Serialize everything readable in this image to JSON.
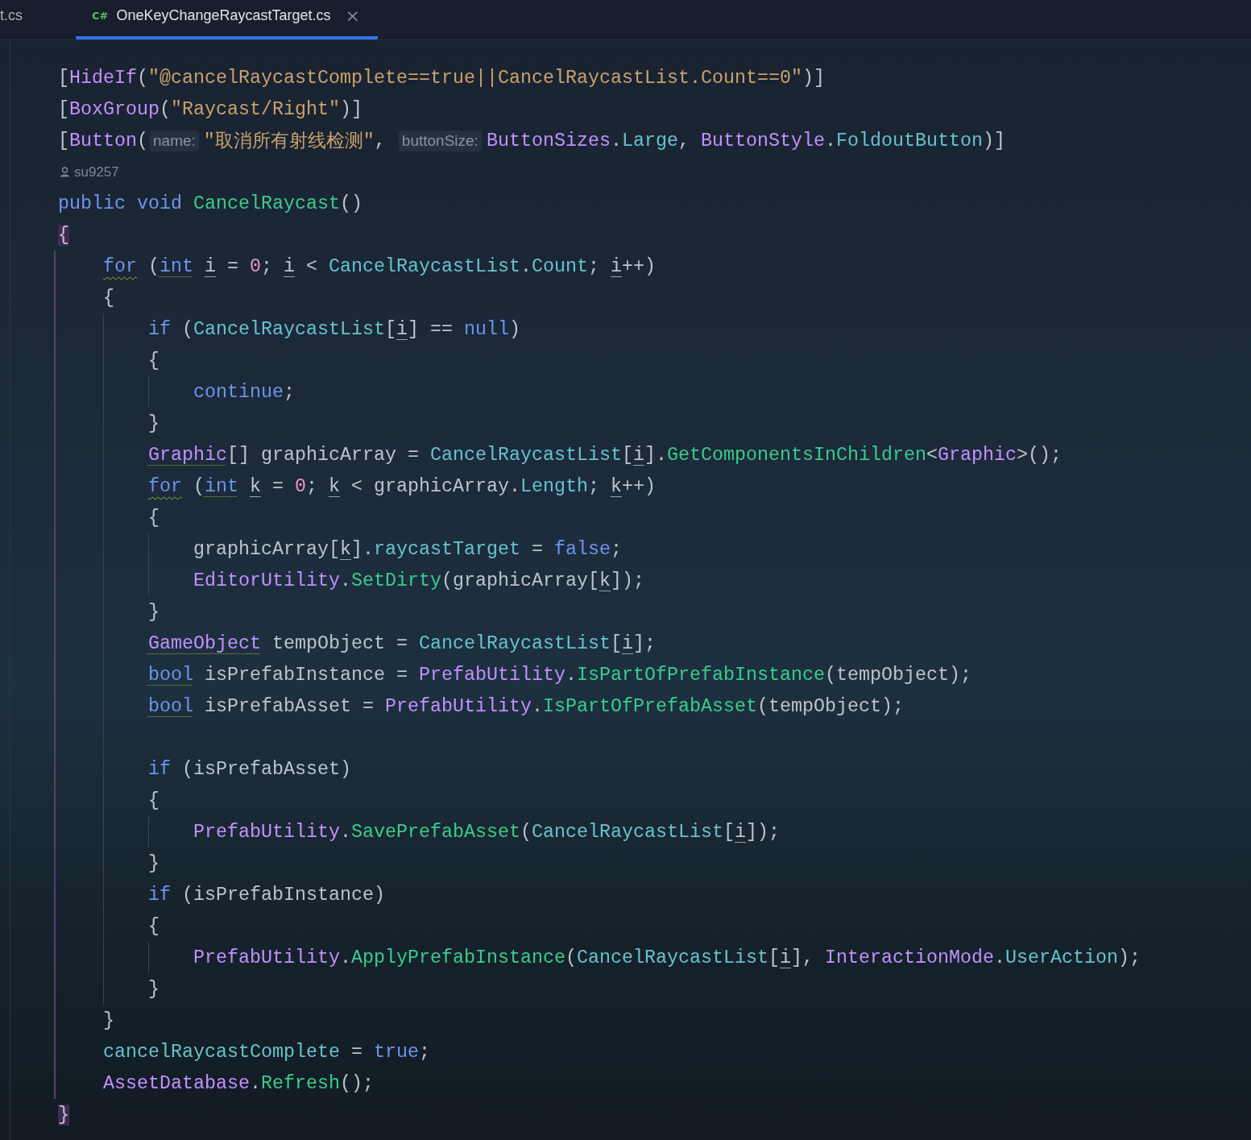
{
  "tabs": [
    {
      "label": "t.cs",
      "selected": false
    },
    {
      "label": "OneKeyChangeRaycastTarget.cs",
      "selected": true,
      "icon_text": "C#",
      "close": "×"
    }
  ],
  "lines": [
    {
      "kind": "code",
      "tokens": [
        {
          "text": "[",
          "kind": "plain"
        },
        {
          "text": "HideIf",
          "kind": "type"
        },
        {
          "text": "(",
          "kind": "plain"
        },
        {
          "text": "\"@cancelRaycastComplete==true||CancelRaycastList.Count==0\"",
          "kind": "string"
        },
        {
          "text": ")]",
          "kind": "plain"
        }
      ]
    },
    {
      "kind": "code",
      "tokens": [
        {
          "text": "[",
          "kind": "plain"
        },
        {
          "text": "BoxGroup",
          "kind": "type"
        },
        {
          "text": "(",
          "kind": "plain"
        },
        {
          "text": "\"Raycast/Right\"",
          "kind": "string"
        },
        {
          "text": ")]",
          "kind": "plain"
        }
      ]
    },
    {
      "kind": "code",
      "tokens": [
        {
          "text": "[",
          "kind": "plain"
        },
        {
          "text": "Button",
          "kind": "type"
        },
        {
          "text": "(",
          "kind": "plain"
        },
        {
          "text": "name:",
          "kind": "hint"
        },
        {
          "text": "\"取消所有射线检测\"",
          "kind": "string"
        },
        {
          "text": ", ",
          "kind": "plain"
        },
        {
          "text": "buttonSize:",
          "kind": "hint"
        },
        {
          "text": "ButtonSizes",
          "kind": "type"
        },
        {
          "text": ".",
          "kind": "plain"
        },
        {
          "text": "Large",
          "kind": "field"
        },
        {
          "text": ", ",
          "kind": "plain"
        },
        {
          "text": "ButtonStyle",
          "kind": "type"
        },
        {
          "text": ".",
          "kind": "plain"
        },
        {
          "text": "FoldoutButton",
          "kind": "field"
        },
        {
          "text": ")]",
          "kind": "plain"
        }
      ]
    },
    {
      "kind": "author",
      "text": "su9257"
    },
    {
      "kind": "code",
      "tokens": [
        {
          "text": "public void ",
          "kind": "keyword"
        },
        {
          "text": "CancelRaycast",
          "kind": "method"
        },
        {
          "text": "()",
          "kind": "plain"
        }
      ]
    },
    {
      "kind": "code",
      "tokens": [
        {
          "text": "{",
          "kind": "plain",
          "matched": true
        }
      ]
    },
    {
      "kind": "code",
      "tokens": [
        {
          "text": "    for",
          "kind": "keyword",
          "warning": true
        },
        {
          "text": " (",
          "kind": "plain"
        },
        {
          "text": "int ",
          "kind": "keyword",
          "suggestion": true
        },
        {
          "text": "i",
          "kind": "plain",
          "mutable": true
        },
        {
          "text": " = ",
          "kind": "plain"
        },
        {
          "text": "0",
          "kind": "number"
        },
        {
          "text": "; ",
          "kind": "plain"
        },
        {
          "text": "i",
          "kind": "plain",
          "mutable": true
        },
        {
          "text": " < ",
          "kind": "plain"
        },
        {
          "text": "CancelRaycastList",
          "kind": "field"
        },
        {
          "text": ".",
          "kind": "plain"
        },
        {
          "text": "Count",
          "kind": "field"
        },
        {
          "text": "; ",
          "kind": "plain"
        },
        {
          "text": "i",
          "kind": "plain",
          "mutable": true
        },
        {
          "text": "++)",
          "kind": "plain"
        }
      ]
    },
    {
      "kind": "code",
      "tokens": [
        {
          "text": "    {",
          "kind": "plain"
        }
      ]
    },
    {
      "kind": "code",
      "tokens": [
        {
          "text": "        if",
          "kind": "keyword"
        },
        {
          "text": " (",
          "kind": "plain"
        },
        {
          "text": "CancelRaycastList",
          "kind": "field"
        },
        {
          "text": "[",
          "kind": "plain"
        },
        {
          "text": "i",
          "kind": "plain",
          "mutable": true
        },
        {
          "text": "] == ",
          "kind": "plain"
        },
        {
          "text": "null",
          "kind": "keyword"
        },
        {
          "text": ")",
          "kind": "plain"
        }
      ]
    },
    {
      "kind": "code",
      "tokens": [
        {
          "text": "        {",
          "kind": "plain"
        }
      ]
    },
    {
      "kind": "code",
      "tokens": [
        {
          "text": "            continue",
          "kind": "keyword"
        },
        {
          "text": ";",
          "kind": "plain"
        }
      ]
    },
    {
      "kind": "code",
      "tokens": [
        {
          "text": "        }",
          "kind": "plain"
        }
      ]
    },
    {
      "kind": "code",
      "tokens": [
        {
          "text": "        Graphic",
          "kind": "type",
          "suggestion": true
        },
        {
          "text": "[] graphicArray = ",
          "kind": "plain"
        },
        {
          "text": "CancelRaycastList",
          "kind": "field"
        },
        {
          "text": "[",
          "kind": "plain"
        },
        {
          "text": "i",
          "kind": "plain",
          "mutable": true
        },
        {
          "text": "].",
          "kind": "plain"
        },
        {
          "text": "GetComponentsInChildren",
          "kind": "method"
        },
        {
          "text": "<",
          "kind": "plain"
        },
        {
          "text": "Graphic",
          "kind": "type"
        },
        {
          "text": ">();",
          "kind": "plain"
        }
      ]
    },
    {
      "kind": "code",
      "tokens": [
        {
          "text": "        for",
          "kind": "keyword",
          "warning": true
        },
        {
          "text": " (",
          "kind": "plain"
        },
        {
          "text": "int ",
          "kind": "keyword",
          "suggestion": true
        },
        {
          "text": "k",
          "kind": "plain",
          "mutable": true
        },
        {
          "text": " = ",
          "kind": "plain"
        },
        {
          "text": "0",
          "kind": "number"
        },
        {
          "text": "; ",
          "kind": "plain"
        },
        {
          "text": "k",
          "kind": "plain",
          "mutable": true
        },
        {
          "text": " < graphicArray.",
          "kind": "plain"
        },
        {
          "text": "Length",
          "kind": "field"
        },
        {
          "text": "; ",
          "kind": "plain"
        },
        {
          "text": "k",
          "kind": "plain",
          "mutable": true
        },
        {
          "text": "++)",
          "kind": "plain"
        }
      ]
    },
    {
      "kind": "code",
      "tokens": [
        {
          "text": "        {",
          "kind": "plain"
        }
      ]
    },
    {
      "kind": "code",
      "tokens": [
        {
          "text": "            graphicArray[",
          "kind": "plain"
        },
        {
          "text": "k",
          "kind": "plain",
          "mutable": true
        },
        {
          "text": "].",
          "kind": "plain"
        },
        {
          "text": "raycastTarget",
          "kind": "field"
        },
        {
          "text": " = ",
          "kind": "plain"
        },
        {
          "text": "false",
          "kind": "keyword"
        },
        {
          "text": ";",
          "kind": "plain"
        }
      ]
    },
    {
      "kind": "code",
      "tokens": [
        {
          "text": "            EditorUtility",
          "kind": "type"
        },
        {
          "text": ".SetDirty",
          "kind": "method"
        },
        {
          "text": "(graphicArray[",
          "kind": "plain"
        },
        {
          "text": "k",
          "kind": "plain",
          "mutable": true
        },
        {
          "text": "]);",
          "kind": "plain"
        }
      ]
    },
    {
      "kind": "code",
      "tokens": [
        {
          "text": "        }",
          "kind": "plain"
        }
      ]
    },
    {
      "kind": "code",
      "tokens": [
        {
          "text": "        GameObject",
          "kind": "type",
          "suggestion": true
        },
        {
          "text": " tempObject = ",
          "kind": "plain"
        },
        {
          "text": "CancelRaycastList",
          "kind": "field"
        },
        {
          "text": "[",
          "kind": "plain"
        },
        {
          "text": "i",
          "kind": "plain",
          "mutable": true
        },
        {
          "text": "];",
          "kind": "plain"
        }
      ]
    },
    {
      "kind": "code",
      "tokens": [
        {
          "text": "        bool",
          "kind": "keyword",
          "suggestion": true
        },
        {
          "text": " isPrefabInstance = ",
          "kind": "plain"
        },
        {
          "text": "PrefabUtility",
          "kind": "type"
        },
        {
          "text": ".IsPartOfPrefabInstance",
          "kind": "method"
        },
        {
          "text": "(tempObject);",
          "kind": "plain"
        }
      ]
    },
    {
      "kind": "code",
      "tokens": [
        {
          "text": "        bool",
          "kind": "keyword",
          "suggestion": true
        },
        {
          "text": " isPrefabAsset = ",
          "kind": "plain"
        },
        {
          "text": "PrefabUtility",
          "kind": "type"
        },
        {
          "text": ".IsPartOfPrefabAsset",
          "kind": "method"
        },
        {
          "text": "(tempObject);",
          "kind": "plain"
        }
      ]
    },
    {
      "kind": "blank"
    },
    {
      "kind": "code",
      "tokens": [
        {
          "text": "        if",
          "kind": "keyword"
        },
        {
          "text": " (isPrefabAsset)",
          "kind": "plain"
        }
      ]
    },
    {
      "kind": "code",
      "tokens": [
        {
          "text": "        {",
          "kind": "plain"
        }
      ]
    },
    {
      "kind": "code",
      "tokens": [
        {
          "text": "            PrefabUtility",
          "kind": "type"
        },
        {
          "text": ".",
          "kind": "plain"
        },
        {
          "text": "SavePrefabAsset",
          "kind": "method"
        },
        {
          "text": "(",
          "kind": "plain"
        },
        {
          "text": "CancelRaycastList",
          "kind": "field"
        },
        {
          "text": "[",
          "kind": "plain"
        },
        {
          "text": "i",
          "kind": "plain",
          "mutable": true
        },
        {
          "text": "]);",
          "kind": "plain"
        }
      ]
    },
    {
      "kind": "code",
      "tokens": [
        {
          "text": "        }",
          "kind": "plain"
        }
      ]
    },
    {
      "kind": "code",
      "tokens": [
        {
          "text": "        if",
          "kind": "keyword"
        },
        {
          "text": " (isPrefabInstance)",
          "kind": "plain"
        }
      ]
    },
    {
      "kind": "code",
      "tokens": [
        {
          "text": "        {",
          "kind": "plain"
        }
      ]
    },
    {
      "kind": "code",
      "tokens": [
        {
          "text": "            PrefabUtility",
          "kind": "type"
        },
        {
          "text": ".",
          "kind": "plain"
        },
        {
          "text": "ApplyPrefabInstance",
          "kind": "method"
        },
        {
          "text": "(",
          "kind": "plain"
        },
        {
          "text": "CancelRaycastList",
          "kind": "field"
        },
        {
          "text": "[",
          "kind": "plain"
        },
        {
          "text": "i",
          "kind": "plain",
          "mutable": true
        },
        {
          "text": "], ",
          "kind": "plain"
        },
        {
          "text": "InteractionMode",
          "kind": "type"
        },
        {
          "text": ".",
          "kind": "plain"
        },
        {
          "text": "UserAction",
          "kind": "field"
        },
        {
          "text": ");",
          "kind": "plain"
        }
      ]
    },
    {
      "kind": "code",
      "tokens": [
        {
          "text": "        }",
          "kind": "plain"
        }
      ]
    },
    {
      "kind": "code",
      "tokens": [
        {
          "text": "    }",
          "kind": "plain"
        }
      ]
    },
    {
      "kind": "code",
      "tokens": [
        {
          "text": "    cancelRaycastComplete",
          "kind": "field"
        },
        {
          "text": " = ",
          "kind": "plain"
        },
        {
          "text": "true",
          "kind": "keyword"
        },
        {
          "text": ";",
          "kind": "plain"
        }
      ]
    },
    {
      "kind": "code",
      "tokens": [
        {
          "text": "    AssetDatabase",
          "kind": "type"
        },
        {
          "text": ".Refresh",
          "kind": "method"
        },
        {
          "text": "();",
          "kind": "plain"
        }
      ]
    },
    {
      "kind": "code",
      "tokens": [
        {
          "text": "}",
          "kind": "plain",
          "matched": true
        }
      ]
    }
  ]
}
